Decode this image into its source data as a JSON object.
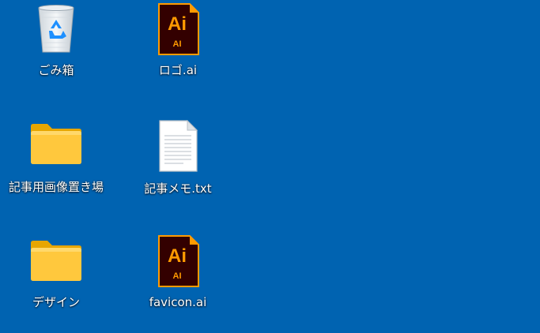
{
  "desktop": {
    "background_color": "#0063b1",
    "icons": [
      {
        "label": "ごみ箱",
        "icon": "recycle-bin-icon"
      },
      {
        "label": "ロゴ.ai",
        "icon": "illustrator-file-icon",
        "badge_main": "Ai",
        "badge_sub": "AI"
      },
      {
        "label": "記事用画像置き場",
        "icon": "folder-icon"
      },
      {
        "label": "記事メモ.txt",
        "icon": "text-file-icon"
      },
      {
        "label": "デザイン",
        "icon": "folder-icon"
      },
      {
        "label": "favicon.ai",
        "icon": "illustrator-file-icon",
        "badge_main": "Ai",
        "badge_sub": "AI"
      }
    ]
  },
  "colors": {
    "illustrator_bg": "#330000",
    "illustrator_accent": "#ff9a00",
    "folder": "#ffc83d"
  }
}
